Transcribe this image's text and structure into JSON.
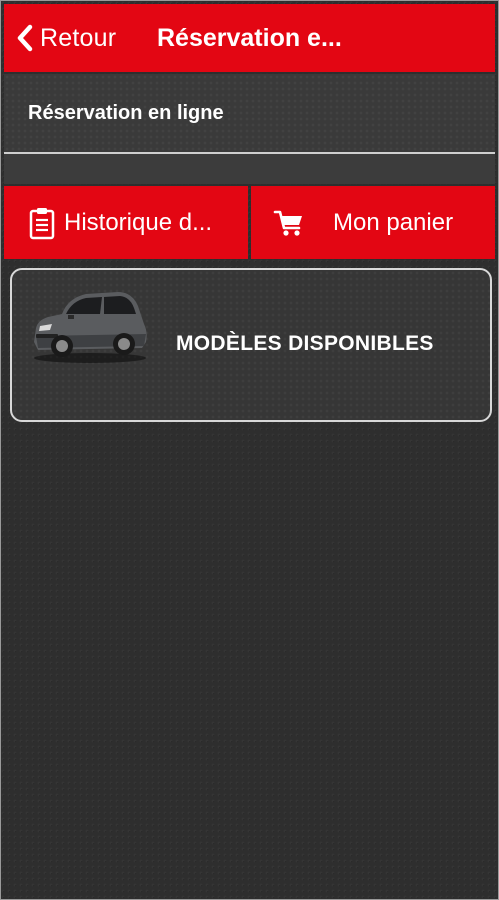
{
  "header": {
    "back_label": "Retour",
    "title": "Réservation e...",
    "background_color": "#e30613",
    "back_icon": "chevron-left-icon"
  },
  "subheader": {
    "text": "Réservation en ligne"
  },
  "tabs": [
    {
      "label": "Historique d...",
      "icon": "clipboard-icon"
    },
    {
      "label": "Mon panier",
      "icon": "shopping-cart-icon"
    }
  ],
  "models_card": {
    "label": "MODÈLES DISPONIBLES",
    "image": "car-image",
    "border_color": "#d8d8d8"
  },
  "theme": {
    "accent": "#e30613",
    "background": "#2e2e2e",
    "text": "#ffffff"
  }
}
